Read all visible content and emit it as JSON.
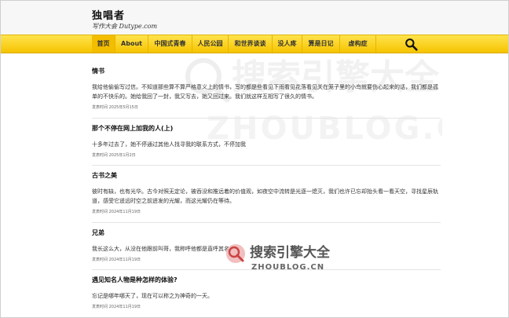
{
  "site": {
    "title": "独唱者",
    "subtitle": "写作大会 Dutype.com"
  },
  "nav": {
    "items": [
      {
        "label": "首页",
        "active": true
      },
      {
        "label": "About",
        "active": false
      },
      {
        "label": "中国式青春",
        "active": false
      },
      {
        "label": "人民公园",
        "active": false
      },
      {
        "label": "和世界谈谈",
        "active": false
      },
      {
        "label": "没人疼",
        "active": false
      },
      {
        "label": "算是日记",
        "active": false
      },
      {
        "label": "虚构症",
        "active": false
      }
    ],
    "search_icon": "search-icon"
  },
  "posts": [
    {
      "title": "情书",
      "excerpt": "我给他偷偷写过信。不知道那些算不算严格意义上的情书，写的都是些看见下雨看见花落看见关在笼子里的小鸟就要伤心起来的话，我们都是孤单的不快乐的。她给我回了一封，我又写去，她又回过来。我们就这样互相写了很久的情书。",
      "date": "发表时间 2025年5月15日"
    },
    {
      "title": "那个不停在网上加我的人(上)",
      "excerpt": "十多年过去了，她不停通过其他人找寻我的联系方式，不停加我",
      "date": "发表时间 2025年1月2日"
    },
    {
      "title": "古书之美",
      "excerpt": "彼时有缺，也有光华。古今对照无定论，被吞没和推远着的价值观，如夜空中流转是光逐一熄灭，我们也许已忘却抬头看一看天空，寻找星辰轨道，感受它遥远时空之前迸发的光耀，而这光耀仍在等待。",
      "date": "发表时间 2024年11月19日"
    },
    {
      "title": "兄弟",
      "excerpt": "我长这么大，从没在他跟前叫哥，我称呼他都是直呼其名。",
      "date": "发表时间 2024年11月19日"
    },
    {
      "title": "遇见知名人物是种怎样的体验?",
      "excerpt": "忘记是哪年哪天了，现在可以称之为神奇的一天。",
      "date": "发表时间 2024年11月19日"
    }
  ],
  "watermark": {
    "cn": "搜索引擎大全",
    "en": "ZHOUBLOG.CN"
  }
}
